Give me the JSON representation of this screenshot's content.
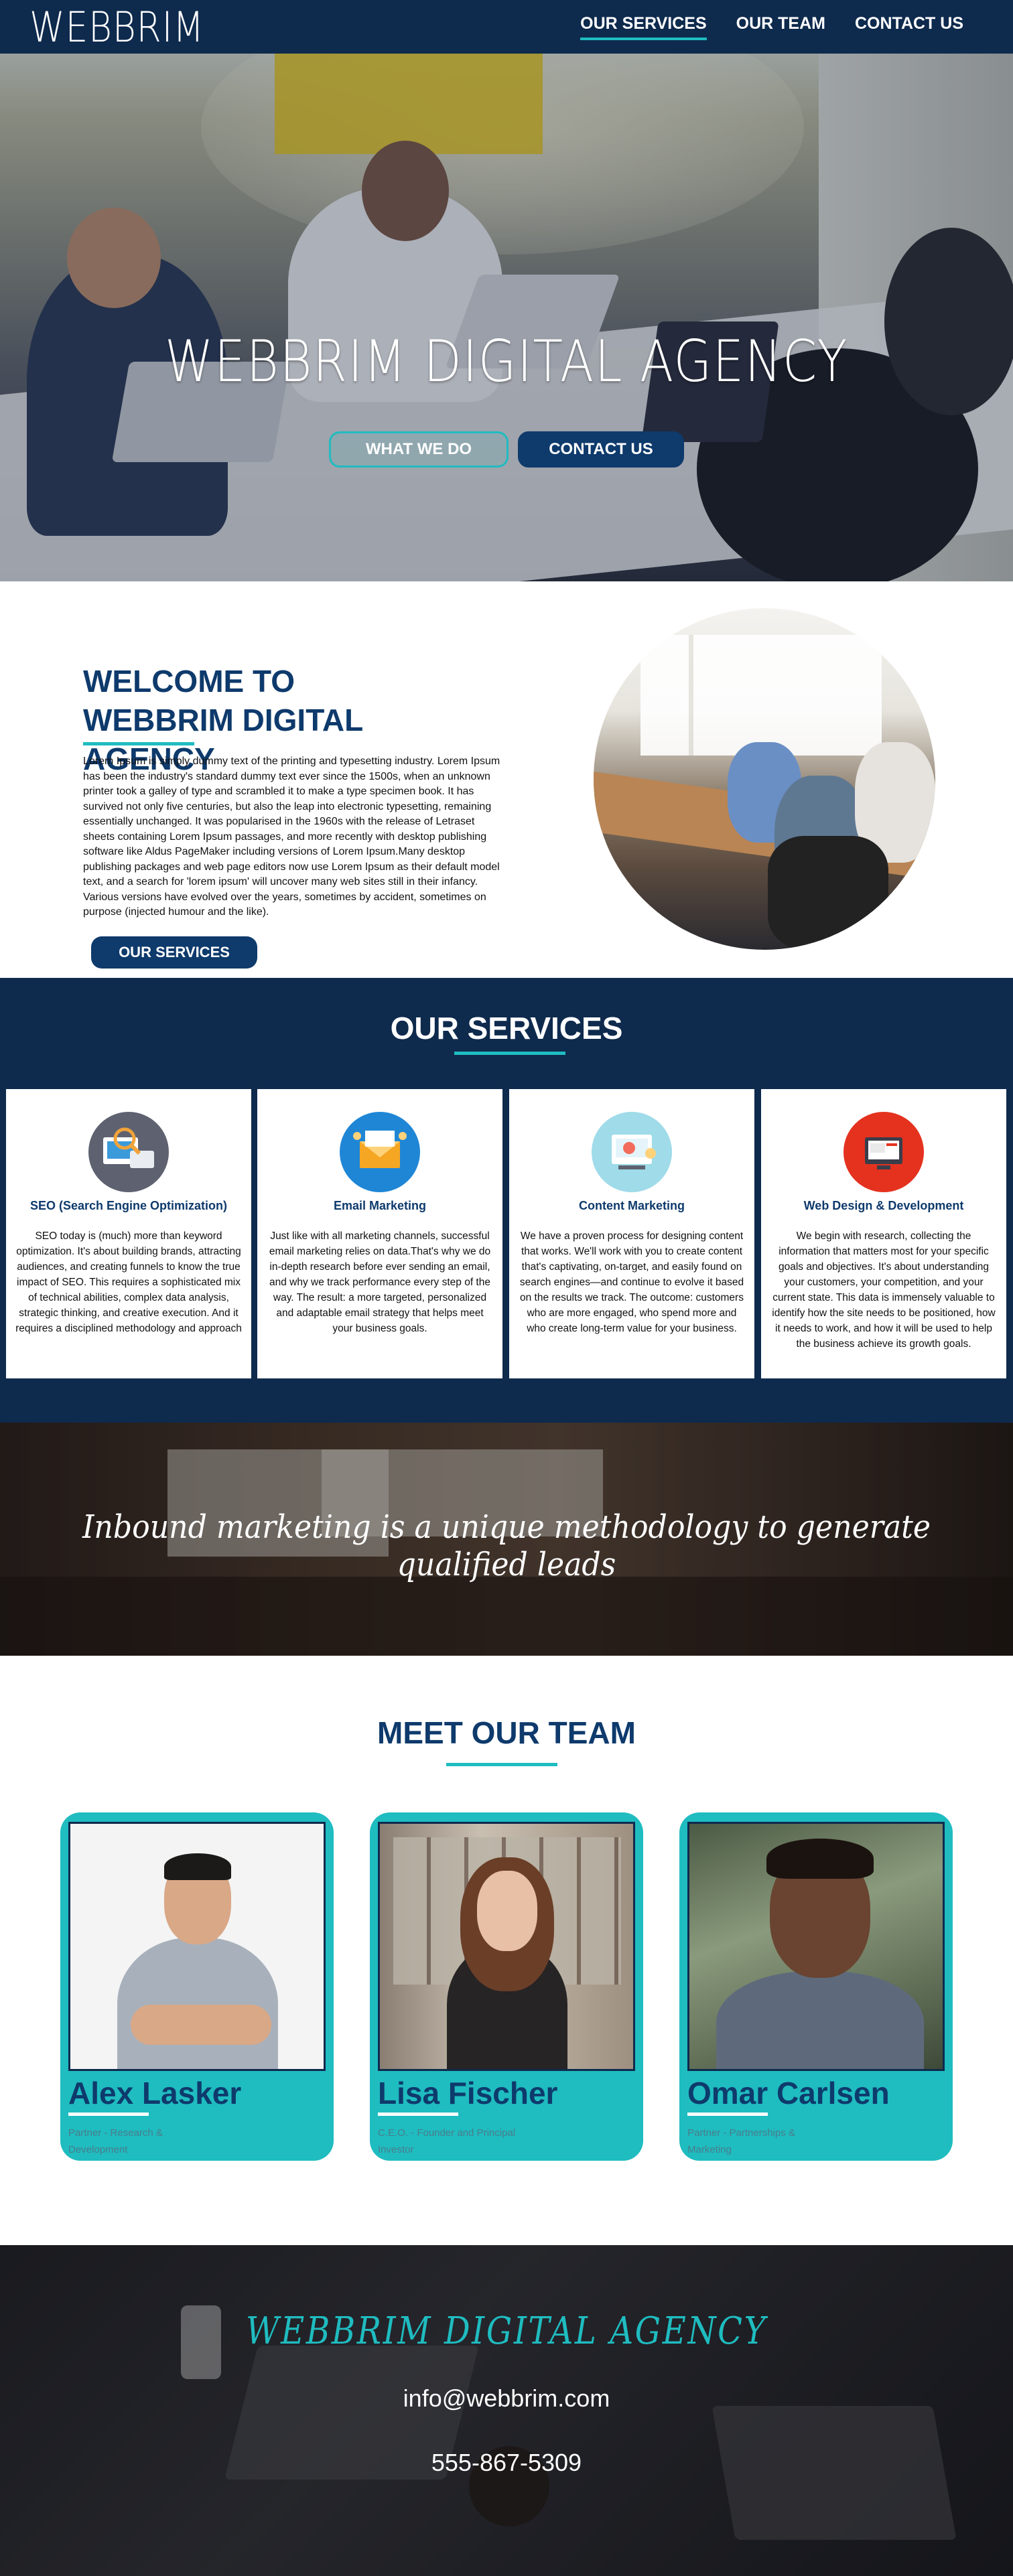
{
  "nav": {
    "logo": "WEBBRIM",
    "links": [
      "OUR SERVICES",
      "OUR TEAM",
      "CONTACT US"
    ],
    "active_index": 0
  },
  "hero": {
    "title": "WEBBRIM DIGITAL AGENCY",
    "button_primary": "WHAT WE DO",
    "button_secondary": "CONTACT US"
  },
  "welcome": {
    "title": "WELCOME TO WEBBRIM DIGITAL AGENCY",
    "body": "Lorem Ipsum is simply dummy text of the printing and typesetting industry. Lorem Ipsum has been the industry's standard dummy text ever since the 1500s, when an unknown printer took a galley of type and scrambled it to make a type specimen book. It has survived not only five centuries, but also the leap into electronic typesetting, remaining essentially unchanged. It was popularised in the 1960s with the release of Letraset sheets containing Lorem Ipsum passages, and more recently with desktop publishing software like Aldus PageMaker including versions of Lorem Ipsum.Many desktop publishing packages and web page editors now use Lorem Ipsum as their default model text, and a search for 'lorem ipsum' will uncover many web sites still in their infancy. Various versions have evolved over the years, sometimes by accident, sometimes on purpose (injected humour and the like).",
    "button": "OUR SERVICES"
  },
  "services": {
    "title": "OUR SERVICES",
    "items": [
      {
        "icon": "seo-icon",
        "title": "SEO (Search Engine Optimization)",
        "text": "SEO today is (much) more than keyword optimization. It's about building brands, attracting audiences, and creating funnels to know the true impact of SEO. This requires a sophisticated mix of technical abilities, complex data analysis, strategic thinking, and creative execution. And it requires a disciplined methodology and approach"
      },
      {
        "icon": "email-icon",
        "title": "Email Marketing",
        "text": "Just like with all marketing channels, successful email marketing relies on data.That's why we do in-depth research before ever sending an email, and why we track performance every step of the way. The result: a more targeted, personalized and adaptable email strategy that helps meet your business goals."
      },
      {
        "icon": "content-icon",
        "title": "Content Marketing",
        "text": "We have a proven process for designing content that works. We'll work with you to create content that's captivating, on-target, and easily found on search engines—and continue to evolve it based on the results we track. The outcome: customers who are more engaged, who spend more and who create long-term value for your business."
      },
      {
        "icon": "web-design-icon",
        "title": "Web Design & Development",
        "text": "We begin with research, collecting the information that matters most for your specific goals and objectives. It's about understanding your customers, your competition, and your current state. This data is immensely valuable to identify how the site needs to be positioned, how it needs to work, and how it will be used to help the business achieve its growth goals."
      }
    ]
  },
  "quote": {
    "text": "Inbound marketing is a unique methodology to generate qualified leads"
  },
  "team": {
    "title": "MEET OUR TEAM",
    "members": [
      {
        "name": "Alex Lasker",
        "role": "Partner - Research & Development"
      },
      {
        "name": "Lisa Fischer",
        "role": "C.E.O. - Founder and Principal Investor"
      },
      {
        "name": "Omar Carlsen",
        "role": "Partner - Partnerships & Marketing"
      }
    ]
  },
  "footer": {
    "brand": "WEBBRIM DIGITAL AGENCY",
    "email": "info@webbrim.com",
    "phone": "555-867-5309"
  },
  "colors": {
    "navy": "#0e2a4d",
    "primary": "#0e3a6c",
    "accent": "#1fbcc0"
  }
}
